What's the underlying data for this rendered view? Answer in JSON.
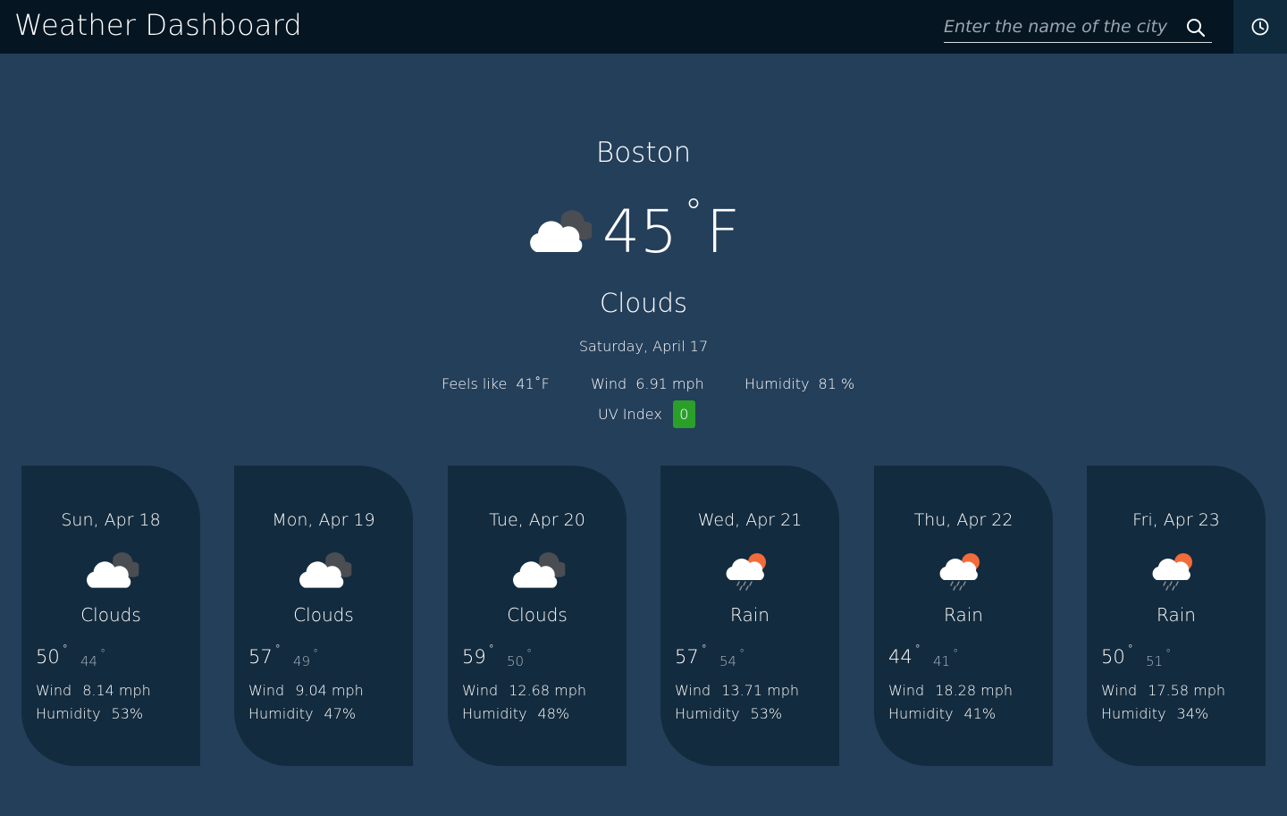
{
  "header": {
    "title": "Weather Dashboard",
    "search_placeholder": "Enter the name of the city",
    "search_icon": "search-icon",
    "history_icon": "clock-icon"
  },
  "current": {
    "city": "Boston",
    "temp": "45",
    "degree": "°",
    "unit": "F",
    "condition": "Clouds",
    "icon": "clouds-icon",
    "date": "Saturday, April 17",
    "feels_like_label": "Feels like",
    "feels_like": "41˚F",
    "wind_label": "Wind",
    "wind": "6.91 mph",
    "humidity_label": "Humidity",
    "humidity": "81 %",
    "uv_label": "UV Index",
    "uv_value": "0",
    "uv_color": "#2aa02a"
  },
  "forecast": [
    {
      "date": "Sun, Apr 18",
      "condition": "Clouds",
      "icon": "clouds-icon",
      "hi": "50",
      "lo": "44",
      "wind_label": "Wind",
      "wind": "8.14 mph",
      "humidity_label": "Humidity",
      "humidity": "53%"
    },
    {
      "date": "Mon, Apr 19",
      "condition": "Clouds",
      "icon": "clouds-icon",
      "hi": "57",
      "lo": "49",
      "wind_label": "Wind",
      "wind": "9.04 mph",
      "humidity_label": "Humidity",
      "humidity": "47%"
    },
    {
      "date": "Tue, Apr 20",
      "condition": "Clouds",
      "icon": "clouds-icon",
      "hi": "59",
      "lo": "50",
      "wind_label": "Wind",
      "wind": "12.68 mph",
      "humidity_label": "Humidity",
      "humidity": "48%"
    },
    {
      "date": "Wed, Apr 21",
      "condition": "Rain",
      "icon": "rain-icon",
      "hi": "57",
      "lo": "54",
      "wind_label": "Wind",
      "wind": "13.71 mph",
      "humidity_label": "Humidity",
      "humidity": "53%"
    },
    {
      "date": "Thu, Apr 22",
      "condition": "Rain",
      "icon": "rain-icon",
      "hi": "44",
      "lo": "41",
      "wind_label": "Wind",
      "wind": "18.28 mph",
      "humidity_label": "Humidity",
      "humidity": "41%"
    },
    {
      "date": "Fri, Apr 23",
      "condition": "Rain",
      "icon": "rain-icon",
      "hi": "50",
      "lo": "51",
      "wind_label": "Wind",
      "wind": "17.58 mph",
      "humidity_label": "Humidity",
      "humidity": "34%"
    }
  ],
  "colors": {
    "background": "#243f5a",
    "topbar": "#051521",
    "card": "#132b3e",
    "uv_ok": "#2aa02a",
    "sun": "#f26b3a"
  }
}
